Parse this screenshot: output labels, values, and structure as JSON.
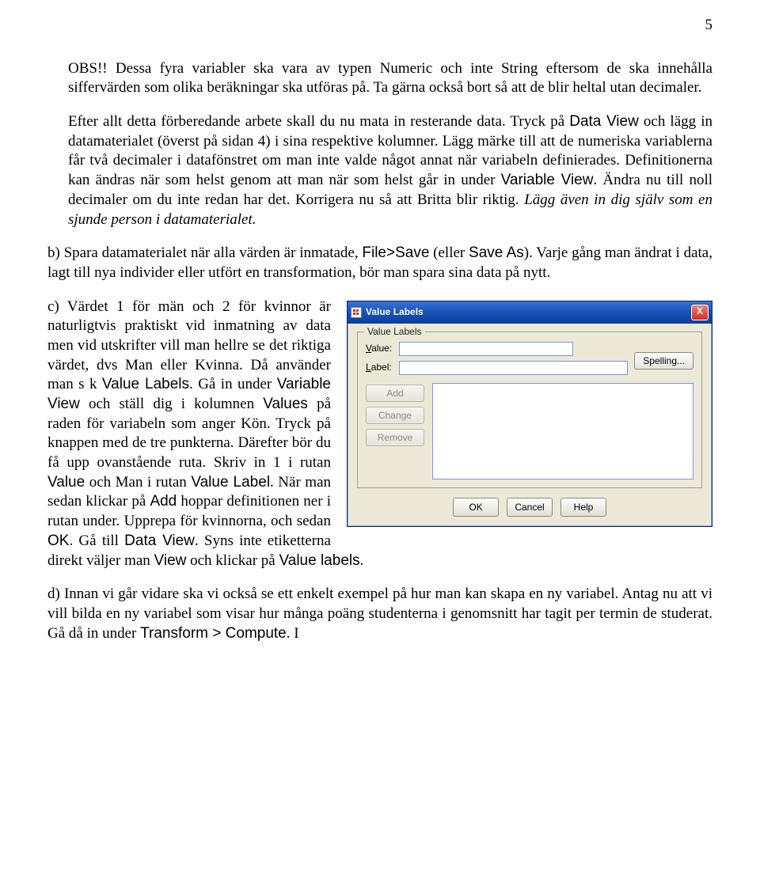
{
  "page": {
    "number": "5"
  },
  "para1": {
    "t1": "OBS!! Dessa fyra variabler ska vara av typen Numeric och inte String eftersom de ska innehålla siffervärden som olika beräkningar ska utföras på. Ta gärna också bort så att de blir heltal utan decimaler."
  },
  "para2": {
    "t1": "Efter allt detta förberedande arbete skall du nu mata in resterande data. Tryck på ",
    "s1": "Data View",
    "t2": " och lägg in datamaterialet (överst på sidan 4) i sina respektive kolumner. Lägg märke till att de numeriska variablerna får två decimaler i datafönstret om man inte valde något annat när variabeln definierades. Definitionerna kan ändras när som helst genom att man när som helst går in under ",
    "s2": "Variable View",
    "t3": ". Ändra nu till noll decimaler om du inte redan har det. Korrigera nu så att Britta blir riktig. ",
    "i1": "Lägg även in dig själv som en sjunde person i datamaterialet."
  },
  "para3": {
    "t1": "b) Spara datamaterialet när alla värden är inmatade, ",
    "s1": "File>Save",
    "t2": " (eller ",
    "s2": "Save As",
    "t3": "). Varje gång man ändrat i data, lagt till nya individer eller utfört en transformation, bör man spara sina data på nytt."
  },
  "para4": {
    "t1": "c) Värdet 1 för män och 2 för kvinnor är naturligtvis praktiskt vid inmatning av data men vid utskrifter vill man hellre se det riktiga värdet, dvs Man eller Kvinna. Då använder man s k ",
    "s1": "Value Labels",
    "t2": ". Gå in under ",
    "s2": "Variable View",
    "t3": " och ställ dig i kolumnen ",
    "s3": "Values",
    "t4": " på raden för variabeln som anger Kön. Tryck på knappen med de tre punkterna. Därefter bör du få upp ovanstående ruta. Skriv in 1 i rutan ",
    "s4": "Value",
    "t5": " och Man i rutan ",
    "s5": "Value Label",
    "t6": ". När man sedan klickar på ",
    "s6": "Add",
    "t7": " hoppar definitionen ner i rutan under. Upprepa för kvinnorna, och sedan ",
    "s7": "OK",
    "t8": ". Gå till ",
    "s8": "Data View",
    "t9": ". Syns inte etiketterna direkt väljer man ",
    "s9": "View",
    "t10": " och klickar på ",
    "s10": "Value labels",
    "t11": "."
  },
  "para5": {
    "t1": "d) Innan vi går vidare ska vi också se ett enkelt exempel på hur man kan skapa en ny variabel. Antag nu att vi vill bilda en ny variabel som visar hur många poäng studenterna i genomsnitt har tagit per termin de studerat. Gå då in under ",
    "s1": "Transform > Compute",
    "t2": ". I"
  },
  "dialog": {
    "title": "Value Labels",
    "groupLabel": "Value Labels",
    "valueLabel_prefix": "V",
    "valueLabel_rest": "alue:",
    "labelLabel_prefix": "L",
    "labelLabel_rest": "abel:",
    "spelling": "Spelling...",
    "add": "Add",
    "change": "Change",
    "remove": "Remove",
    "ok": "OK",
    "cancel": "Cancel",
    "help": "Help",
    "close": "X"
  }
}
